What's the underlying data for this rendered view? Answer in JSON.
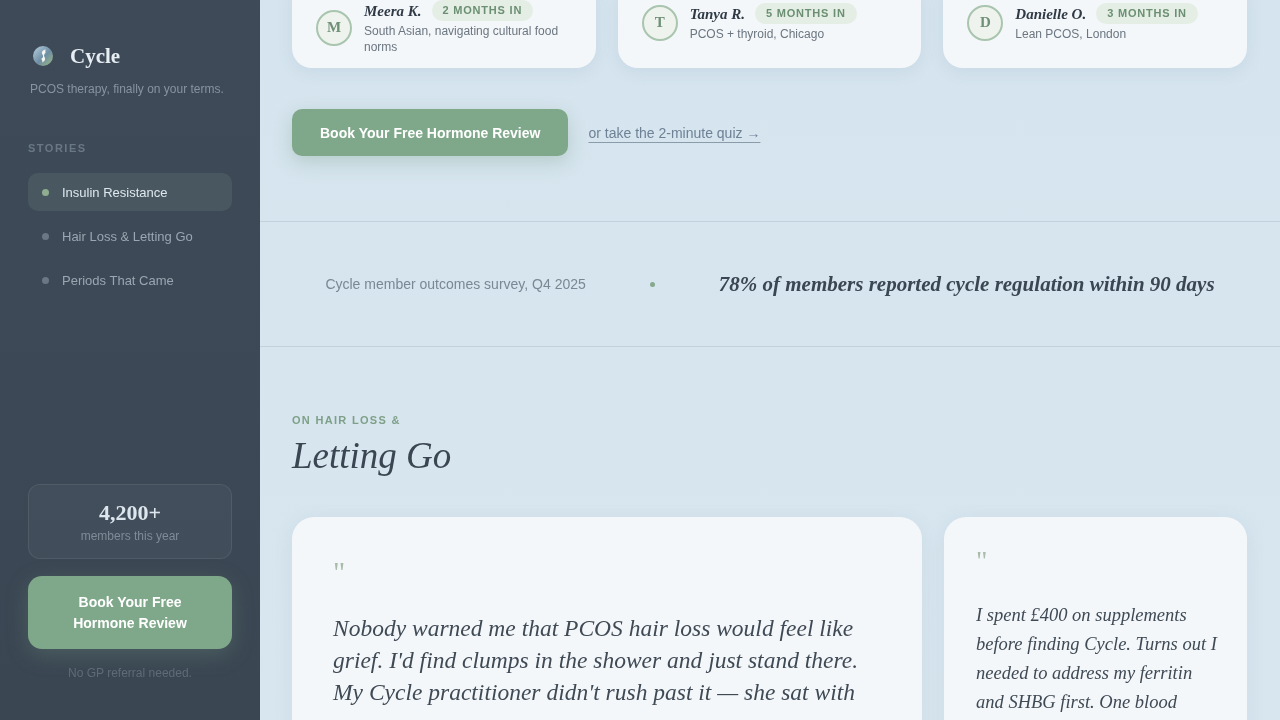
{
  "sidebar": {
    "brand": "Cycle",
    "tagline": "PCOS therapy, finally on your terms.",
    "section_label": "STORIES",
    "items": [
      {
        "label": "Insulin Resistance",
        "selected": true
      },
      {
        "label": "Hair Loss & Letting Go",
        "selected": false
      },
      {
        "label": "Periods That Came",
        "selected": false
      }
    ],
    "stat": {
      "value": "4,200+",
      "label": "members this year"
    },
    "cta": "Book Your Free Hormone Review",
    "note": "No GP referral needed."
  },
  "member_cards": [
    {
      "initial": "M",
      "name": "Meera K.",
      "badge": "2 MONTHS IN",
      "detail": "South Asian, navigating cultural food norms"
    },
    {
      "initial": "T",
      "name": "Tanya R.",
      "badge": "5 MONTHS IN",
      "detail": "PCOS + thyroid, Chicago"
    },
    {
      "initial": "D",
      "name": "Danielle O.",
      "badge": "3 MONTHS IN",
      "detail": "Lean PCOS, London"
    }
  ],
  "actions": {
    "primary": "Book Your Free Hormone Review",
    "link": "or take the 2-minute quiz →"
  },
  "outcome": {
    "source": "Cycle member outcomes survey, Q4 2025",
    "stat": "78% of members reported cycle regulation within 90 days"
  },
  "section": {
    "eyebrow": "ON HAIR LOSS &",
    "title": "Letting Go"
  },
  "quotes": [
    {
      "kind": "featured",
      "mark": "\"",
      "text": "Nobody warned me that PCOS hair loss would feel like grief. I'd find clumps in the shower and just stand there. My Cycle practitioner didn't rush past it — she sat with"
    },
    {
      "kind": "compact",
      "mark": "\"",
      "text": "I spent £400 on supplements before finding Cycle. Turns out I needed to address my ferritin and SHBG first. One blood"
    }
  ]
}
